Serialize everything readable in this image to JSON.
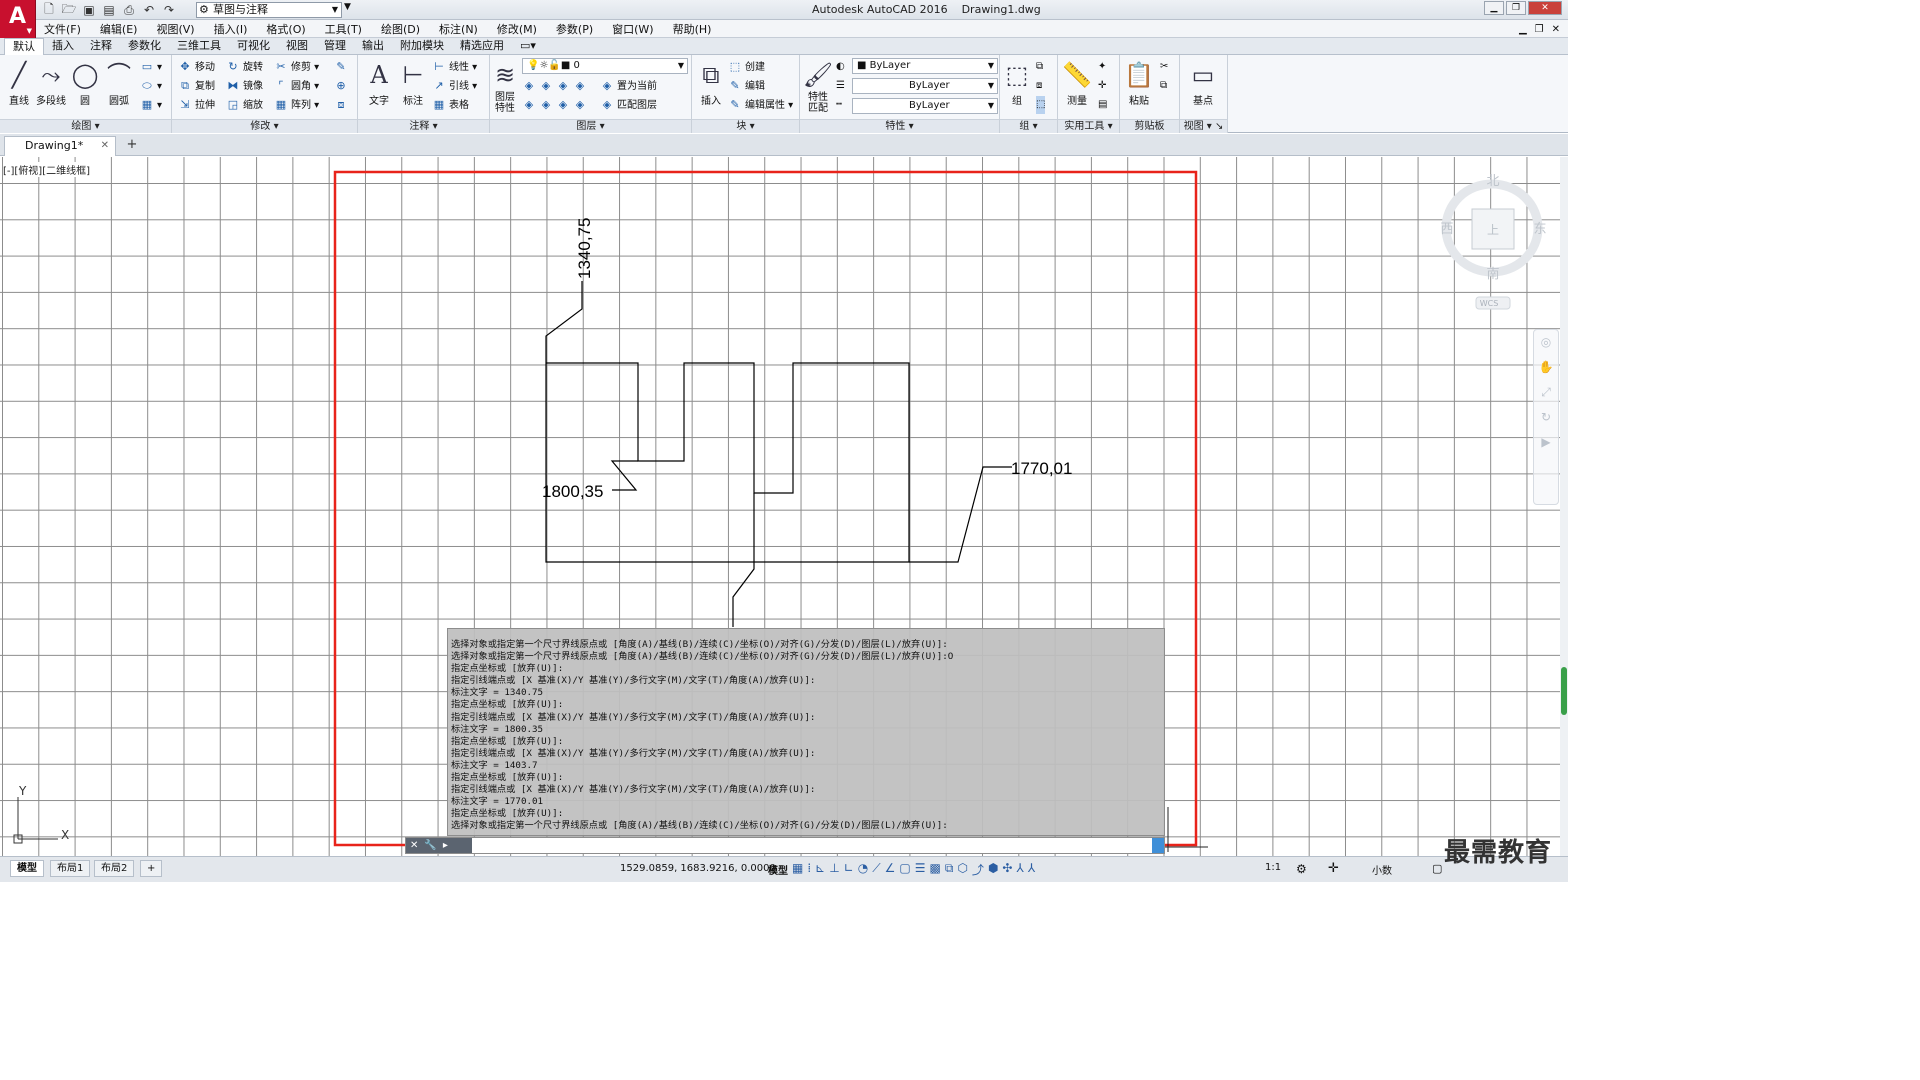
{
  "app": {
    "logo_letter": "A",
    "window_title": "Autodesk AutoCAD 2016    Drawing1.dwg",
    "workspace": "草图与注释"
  },
  "menu": [
    "文件(F)",
    "编辑(E)",
    "视图(V)",
    "插入(I)",
    "格式(O)",
    "工具(T)",
    "绘图(D)",
    "标注(N)",
    "修改(M)",
    "参数(P)",
    "窗口(W)",
    "帮助(H)"
  ],
  "ribbon_tabs": [
    "默认",
    "插入",
    "注释",
    "参数化",
    "三维工具",
    "可视化",
    "视图",
    "管理",
    "输出",
    "附加模块",
    "精选应用"
  ],
  "ribbon": {
    "draw": {
      "title": "绘图",
      "line": "直线",
      "polyline": "多段线",
      "circle": "圆",
      "arc": "圆弧"
    },
    "modify": {
      "title": "修改",
      "move": "移动",
      "rotate": "旋转",
      "trim": "修剪",
      "copy": "复制",
      "mirror": "镜像",
      "fillet": "圆角",
      "stretch": "拉伸",
      "scale": "缩放",
      "array": "阵列"
    },
    "annotation": {
      "title": "注释",
      "text": "文字",
      "dimension": "标注",
      "linear": "线性",
      "leader": "引线",
      "table": "表格"
    },
    "layers": {
      "title": "图层",
      "properties": "图层\n特性",
      "current_layer": "0",
      "make_current": "置为当前",
      "match_layer": "匹配图层"
    },
    "block": {
      "title": "块",
      "insert": "插入",
      "create": "创建",
      "edit": "编辑",
      "edit_attr": "编辑属性"
    },
    "properties": {
      "title": "特性",
      "match": "特性\n匹配",
      "color": "ByLayer",
      "linetype": "ByLayer",
      "lineweight": "ByLayer"
    },
    "groups": {
      "title": "组",
      "group": "组"
    },
    "utilities": {
      "title": "实用工具",
      "measure": "测量"
    },
    "clipboard": {
      "title": "剪贴板",
      "paste": "粘贴"
    },
    "view": {
      "title": "视图",
      "base": "基点"
    }
  },
  "doc_tab": "Drawing1*",
  "viewport_label": "[-][俯视][二维线框]",
  "viewcube": {
    "north": "北",
    "south": "南",
    "east": "东",
    "west": "西",
    "top": "上",
    "wcs": "WCS"
  },
  "drawing": {
    "labels": [
      "1340,75",
      "1800,35",
      "1770,01"
    ],
    "ucs_x": "X",
    "ucs_y": "Y"
  },
  "command_history": [
    "选择对象或指定第一个尺寸界线原点或 [角度(A)/基线(B)/连续(C)/坐标(O)/对齐(G)/分发(D)/图层(L)/放弃(U)]:",
    "选择对象或指定第一个尺寸界线原点或 [角度(A)/基线(B)/连续(C)/坐标(O)/对齐(G)/分发(D)/图层(L)/放弃(U)]:O",
    "指定点坐标或 [放弃(U)]:",
    "指定引线端点或 [X 基准(X)/Y 基准(Y)/多行文字(M)/文字(T)/角度(A)/放弃(U)]:",
    "标注文字 = 1340.75",
    "指定点坐标或 [放弃(U)]:",
    "指定引线端点或 [X 基准(X)/Y 基准(Y)/多行文字(M)/文字(T)/角度(A)/放弃(U)]:",
    "标注文字 = 1800.35",
    "指定点坐标或 [放弃(U)]:",
    "指定引线端点或 [X 基准(X)/Y 基准(Y)/多行文字(M)/文字(T)/角度(A)/放弃(U)]:",
    "标注文字 = 1403.7",
    "指定点坐标或 [放弃(U)]:",
    "指定引线端点或 [X 基准(X)/Y 基准(Y)/多行文字(M)/文字(T)/角度(A)/放弃(U)]:",
    "标注文字 = 1770.01",
    "指定点坐标或 [放弃(U)]:",
    "选择对象或指定第一个尺寸界线原点或 [角度(A)/基线(B)/连续(C)/坐标(O)/对齐(G)/分发(D)/图层(L)/放弃(U)]:"
  ],
  "status": {
    "layout_tabs": [
      "模型",
      "布局1",
      "布局2"
    ],
    "coords": "1529.0859, 1683.9216, 0.0000",
    "space": "模型",
    "scale": "1:1",
    "units": "小数"
  },
  "watermark": "最需教育",
  "colors": {
    "highlight_rect": "#e8231a",
    "accent": "#c8102e",
    "grid": "#8c8c8c"
  }
}
